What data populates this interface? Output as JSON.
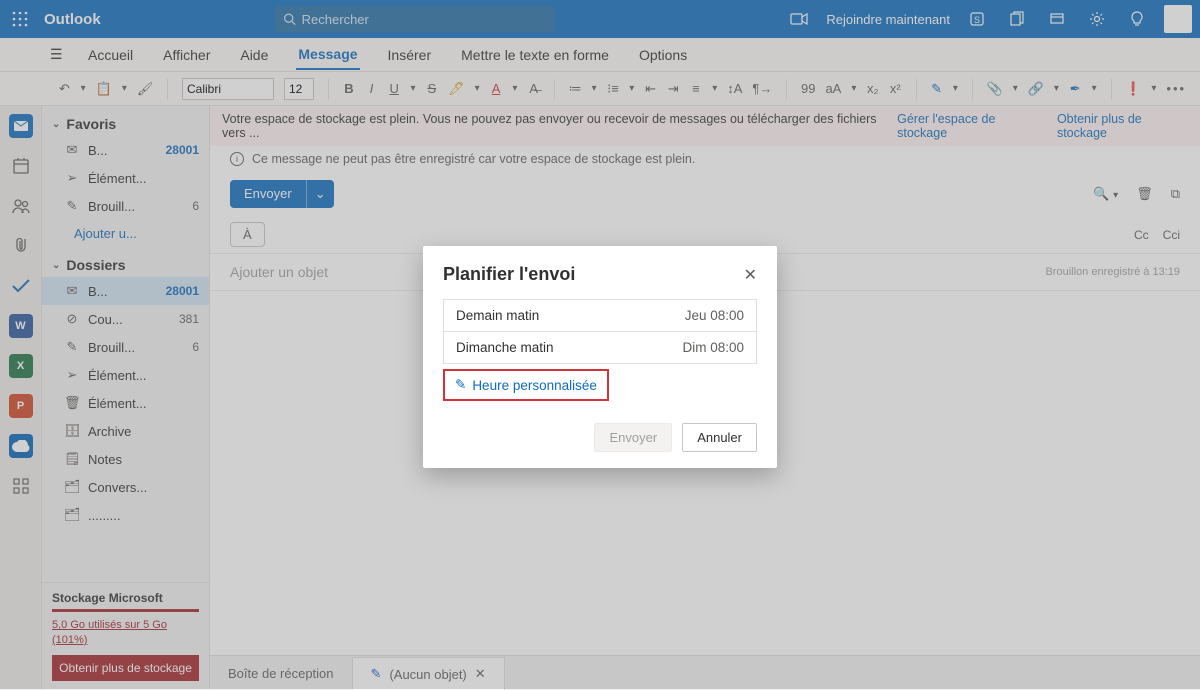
{
  "app": {
    "name": "Outlook"
  },
  "search": {
    "placeholder": "Rechercher"
  },
  "top_right": {
    "join_now": "Rejoindre maintenant"
  },
  "tabs": {
    "home": "Accueil",
    "display": "Afficher",
    "help": "Aide",
    "message": "Message",
    "insert": "Insérer",
    "format": "Mettre le texte en forme",
    "options": "Options"
  },
  "font": {
    "name": "Calibri",
    "size": "12"
  },
  "sidebar": {
    "favorites": "Favoris",
    "folders_label": "Dossiers",
    "add_label": "Ajouter u...",
    "items_fav": [
      {
        "ico": "inbox",
        "label": "B...",
        "count": "28001"
      },
      {
        "ico": "sent",
        "label": "Élément..."
      },
      {
        "ico": "draft",
        "label": "Brouill...",
        "count": "6"
      }
    ],
    "items_fold": [
      {
        "ico": "inbox",
        "label": "B...",
        "count": "28001",
        "sel": true
      },
      {
        "ico": "junk",
        "label": "Cou...",
        "count": "381"
      },
      {
        "ico": "draft",
        "label": "Brouill...",
        "count": "6"
      },
      {
        "ico": "sent",
        "label": "Élément..."
      },
      {
        "ico": "trash",
        "label": "Élément..."
      },
      {
        "ico": "archive",
        "label": "Archive"
      },
      {
        "ico": "note",
        "label": "Notes"
      },
      {
        "ico": "folder",
        "label": "Convers..."
      },
      {
        "ico": "folder",
        "label": "........."
      }
    ]
  },
  "storage": {
    "title": "Stockage Microsoft",
    "usage": "5,0 Go utilisés sur 5 Go (101%)",
    "cta": "Obtenir plus de stockage"
  },
  "warn": {
    "full": "Votre espace de stockage est plein. Vous ne pouvez pas envoyer ou recevoir de messages ou télécharger des fichiers vers ...",
    "manage": "Gérer l'espace de stockage",
    "getmore": "Obtenir plus de stockage",
    "cantsave": "Ce message ne peut pas être enregistré car votre espace de stockage est plein."
  },
  "compose": {
    "send": "Envoyer",
    "to_label": "À",
    "cc": "Cc",
    "bcc": "Cci",
    "subject_placeholder": "Ajouter un objet",
    "draft_saved": "Brouillon enregistré à 13:19"
  },
  "bottom": {
    "inbox": "Boîte de réception",
    "noobj": "(Aucun objet)"
  },
  "modal": {
    "title": "Planifier l'envoi",
    "opt1_label": "Demain matin",
    "opt1_time": "Jeu 08:00",
    "opt2_label": "Dimanche matin",
    "opt2_time": "Dim 08:00",
    "custom": "Heure personnalisée",
    "send": "Envoyer",
    "cancel": "Annuler"
  }
}
